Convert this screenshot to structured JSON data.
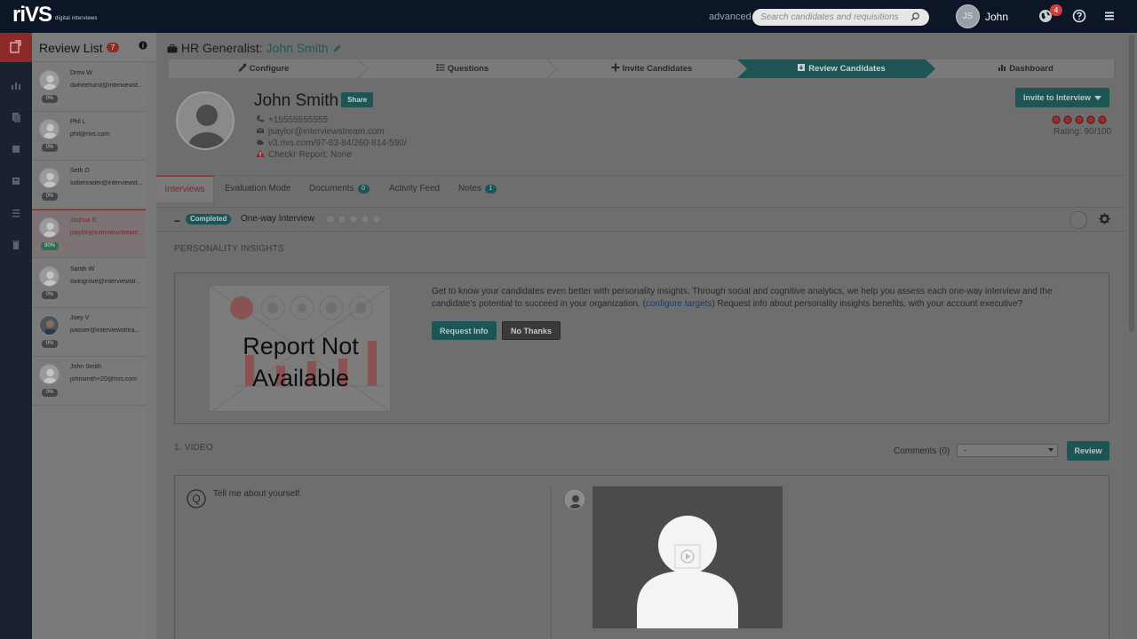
{
  "topbar": {
    "logo": "riVS",
    "logo_sub": "digital interviews",
    "advanced_link": "advanced",
    "search_placeholder": "Search candidates and requisitions",
    "avatar_initials": "JS",
    "user_name": "John",
    "notification_count": "4"
  },
  "review_list": {
    "title": "Review List",
    "count": "7",
    "candidates": [
      {
        "name": "Drew W",
        "email": "dwhitehurst@interviewst...",
        "percent": "0%"
      },
      {
        "name": "Phil L",
        "email": "phil@rivs.com",
        "percent": "0%"
      },
      {
        "name": "Seth O",
        "email": "sobenrader@interviewst...",
        "percent": "0%"
      },
      {
        "name": "Joshua S",
        "email": "jsaylor@interviewstream...",
        "percent": "90%"
      },
      {
        "name": "Sarah W",
        "email": "swingrove@interviewstr...",
        "percent": "0%"
      },
      {
        "name": "Joey V",
        "email": "jvasser@interviewstrea...",
        "percent": "0%"
      },
      {
        "name": "John Smith",
        "email": "johnsmith+20@rivs.com",
        "percent": "0%"
      }
    ]
  },
  "header": {
    "position": "HR Generalist:",
    "candidate": "John Smith"
  },
  "wizard": {
    "steps": [
      "Configure",
      "Questions",
      "Invite Candidates",
      "Review Candidates",
      "Dashboard"
    ]
  },
  "profile": {
    "name": "John Smith",
    "share_label": "Share",
    "phone": "+15555555555",
    "email": "jsaylor@interviewstream.com",
    "link": "v3.rivs.com/97-83-84/260-814-590/",
    "checkr": "Checkr Report: None",
    "invite_label": "Invite to Interview",
    "rating": "Rating: 90/100"
  },
  "tabs": {
    "interviews": "Interviews",
    "evaluation": "Evaluation Mode",
    "documents": "Documents",
    "documents_count": "0",
    "activity": "Activity Feed",
    "notes": "Notes",
    "notes_count": "1"
  },
  "interview": {
    "status": "Completed",
    "title": "One-way Interview"
  },
  "insights": {
    "section_title": "PERSONALITY INSIGHTS",
    "report_line1": "Report Not",
    "report_line2": "Available",
    "desc_part1": "Get to know your candidates even better with personality insights. Through social and cognitive analytics, we help you assess each one-way interview and the candidate's potential to succeed in your organization. (",
    "desc_link": "configure targets",
    "desc_part2": ") Request info about personality insights benefits, with your account executive?",
    "request_label": "Request Info",
    "no_thanks_label": "No Thanks"
  },
  "video": {
    "section_title": "1. VIDEO",
    "comments": "Comments (0)",
    "select_value": "-",
    "review_label": "Review",
    "question_mark": "Q",
    "question": "Tell me about yourself."
  },
  "colors": {
    "topbar": "#0d1626",
    "teal": "#1d5454",
    "red": "#8c2a2a"
  }
}
